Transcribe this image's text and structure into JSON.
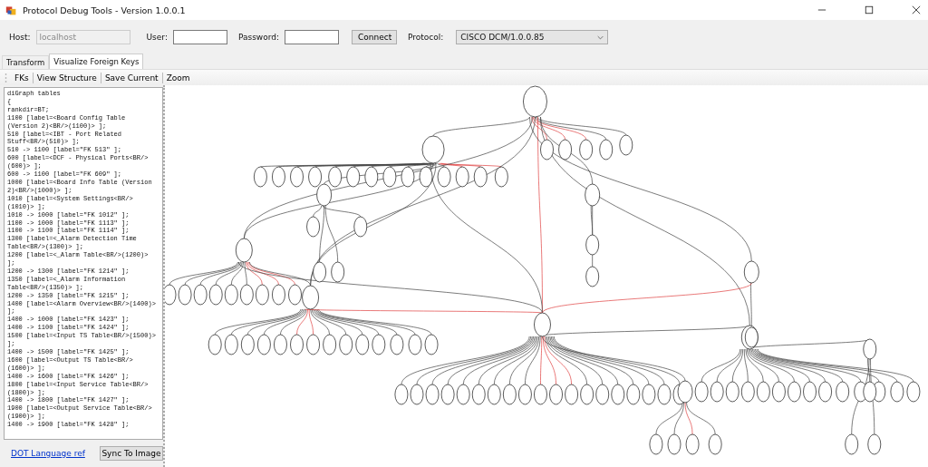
{
  "window": {
    "title": "Protocol Debug Tools - Version 1.0.0.1"
  },
  "connection": {
    "host": {
      "label": "Host:",
      "value": "localhost",
      "disabled": true
    },
    "user": {
      "label": "User:"
    },
    "password": {
      "label": "Password:"
    },
    "connect_button": "Connect",
    "protocol": {
      "label": "Protocol:",
      "value": "CISCO DCM/1.0.0.85"
    }
  },
  "tabs": [
    {
      "label": "Transform",
      "selected": false
    },
    {
      "label": "Visualize Foreign Keys",
      "selected": true
    }
  ],
  "toolbar": [
    "FKs",
    "View Structure",
    "Save Current",
    "Zoom"
  ],
  "editor": {
    "lines": [
      "diGraph tables",
      "{",
      "rankdir=BT;",
      "1100 [label=<Board Config Table",
      "(Version 2)<BR/>(1100)> ];",
      "510 [label=<IBT - Port Related",
      "Stuff<BR/>(510)> ];",
      "510 -> 1100 [label=\"FK 513\" ];",
      "600 [label=<DCF - Physical Ports<BR/>",
      "(600)> ];",
      "600 -> 1100 [label=\"FK 609\" ];",
      "1000 [label=<Board Info Table (Version",
      "2)<BR/>(1000)> ];",
      "1010 [label=<System Settings<BR/>",
      "(1010)> ];",
      "1010 -> 1000 [label=\"FK 1012\" ];",
      "1100 -> 1000 [label=\"FK 1113\" ];",
      "1100 -> 1100 [label=\"FK 1114\" ];",
      "1300 [label=<_Alarm Detection Time",
      "Table<BR/>(1300)> ];",
      "1200 [label=<_Alarm Table<BR/>(1200)>",
      "];",
      "1200 -> 1300 [label=\"FK 1214\" ];",
      "1350 [label=<_Alarm Information",
      "Table<BR/>(1350)> ];",
      "1200 -> 1350 [label=\"FK 1215\" ];",
      "1400 [label=<Alarm Overview<BR/>(1400)>",
      "];",
      "1400 -> 1000 [label=\"FK 1423\" ];",
      "1400 -> 1100 [label=\"FK 1424\" ];",
      "1500 [label=<Input TS Table<BR/>(1500)>",
      "];",
      "1400 -> 1500 [label=\"FK 1425\" ];",
      "1600 [label=<Output TS Table<BR/>",
      "(1600)> ];",
      "1400 -> 1600 [label=\"FK 1426\" ];",
      "1800 [label=<Input Service Table<BR/>",
      "(1800)> ];",
      "1400 -> 1800 [label=\"FK 1427\" ];",
      "1900 [label=<Output Service Table<BR/>",
      "(1900)> ];",
      "1400 -> 1900 [label=\"FK 1428\" ];"
    ]
  },
  "link": "DOT Language ref",
  "sync_button": "Sync To Image"
}
